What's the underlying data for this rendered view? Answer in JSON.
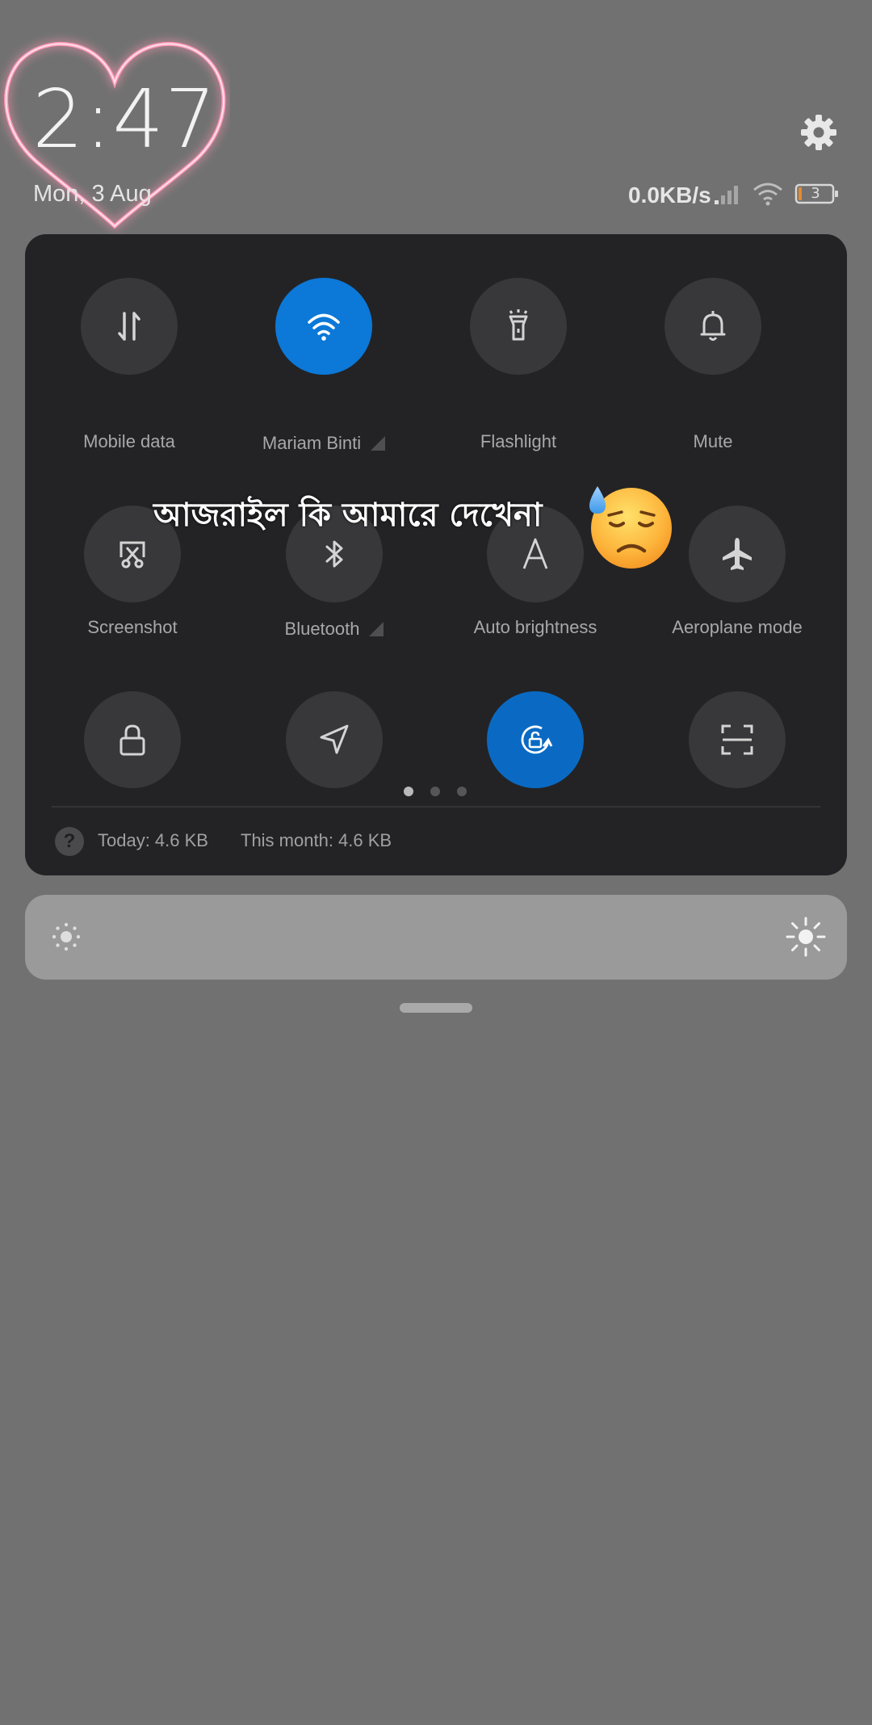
{
  "status_bar": {
    "time": "2:47",
    "date": "Mon, 3 Aug",
    "net_speed": "0.0KB/s",
    "battery_level": "3"
  },
  "icons": {
    "settings": "gear-icon",
    "signal": "signal-icon",
    "wifi_status": "wifi-icon",
    "battery": "battery-icon"
  },
  "quick_settings": {
    "tiles": [
      {
        "label": "Mobile data",
        "icon": "mobile-data-icon",
        "active": false
      },
      {
        "label": "Mariam Binti",
        "icon": "wifi-icon",
        "active": true,
        "expandable": true
      },
      {
        "label": "Flashlight",
        "icon": "flashlight-icon",
        "active": false
      },
      {
        "label": "Mute",
        "icon": "bell-icon",
        "active": false
      },
      {
        "label": "Screenshot",
        "icon": "screenshot-icon",
        "active": false
      },
      {
        "label": "Bluetooth",
        "icon": "bluetooth-icon",
        "active": false,
        "expandable": true
      },
      {
        "label": "Auto brightness",
        "icon": "auto-brightness-icon",
        "active": false
      },
      {
        "label": "Aeroplane mode",
        "icon": "airplane-icon",
        "active": false
      },
      {
        "label": "",
        "icon": "lock-icon",
        "active": false
      },
      {
        "label": "",
        "icon": "location-icon",
        "active": false
      },
      {
        "label": "",
        "icon": "rotation-lock-icon",
        "active": true
      },
      {
        "label": "",
        "icon": "scan-icon",
        "active": false
      }
    ],
    "page_indicator": {
      "pages": 3,
      "current": 1
    },
    "data_usage": {
      "today": "Today: 4.6 KB",
      "month": "This month: 4.6 KB"
    }
  },
  "brightness": {
    "min_icon": "sun-small-icon",
    "max_icon": "sun-large-icon"
  },
  "overlay": {
    "caption": "আজরাইল কি আমারে দেখেনা",
    "emoji": "downcast-face-with-sweat-emoji"
  },
  "colors": {
    "background": "#717171",
    "panel": "#232325",
    "tile": "#38383a",
    "accent": "#0c78d8",
    "heart_neon": "#ff8fb0"
  }
}
